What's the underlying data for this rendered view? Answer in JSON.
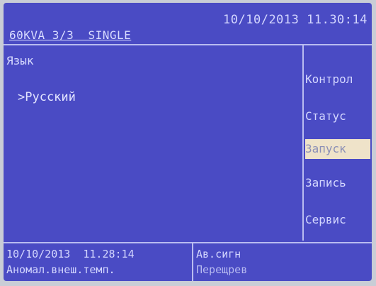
{
  "header": {
    "device_info": "60KVA 3/3  SINGLE",
    "datetime": "10/10/2013 11.30:14"
  },
  "main": {
    "section_title": "Язык",
    "selected_language": ">Русский"
  },
  "menu": {
    "items": [
      {
        "label": "Контрол",
        "active": false
      },
      {
        "label": "Статус",
        "active": false
      },
      {
        "label": "Запуск",
        "active": true
      },
      {
        "label": "Запись",
        "active": false
      },
      {
        "label": "Сервис",
        "active": false
      }
    ]
  },
  "footer": {
    "event_datetime": "10/10/2013  11.28:14",
    "event_description": "Аномал.внеш.темп.",
    "alarm_label": "Ав.сигн",
    "alarm_value": "Перещрев"
  },
  "colors": {
    "screen_bg": "#4a4bc4",
    "text": "#d4d7ff",
    "active_item_bg": "#efe3c9",
    "divider": "#b9bcf0"
  }
}
